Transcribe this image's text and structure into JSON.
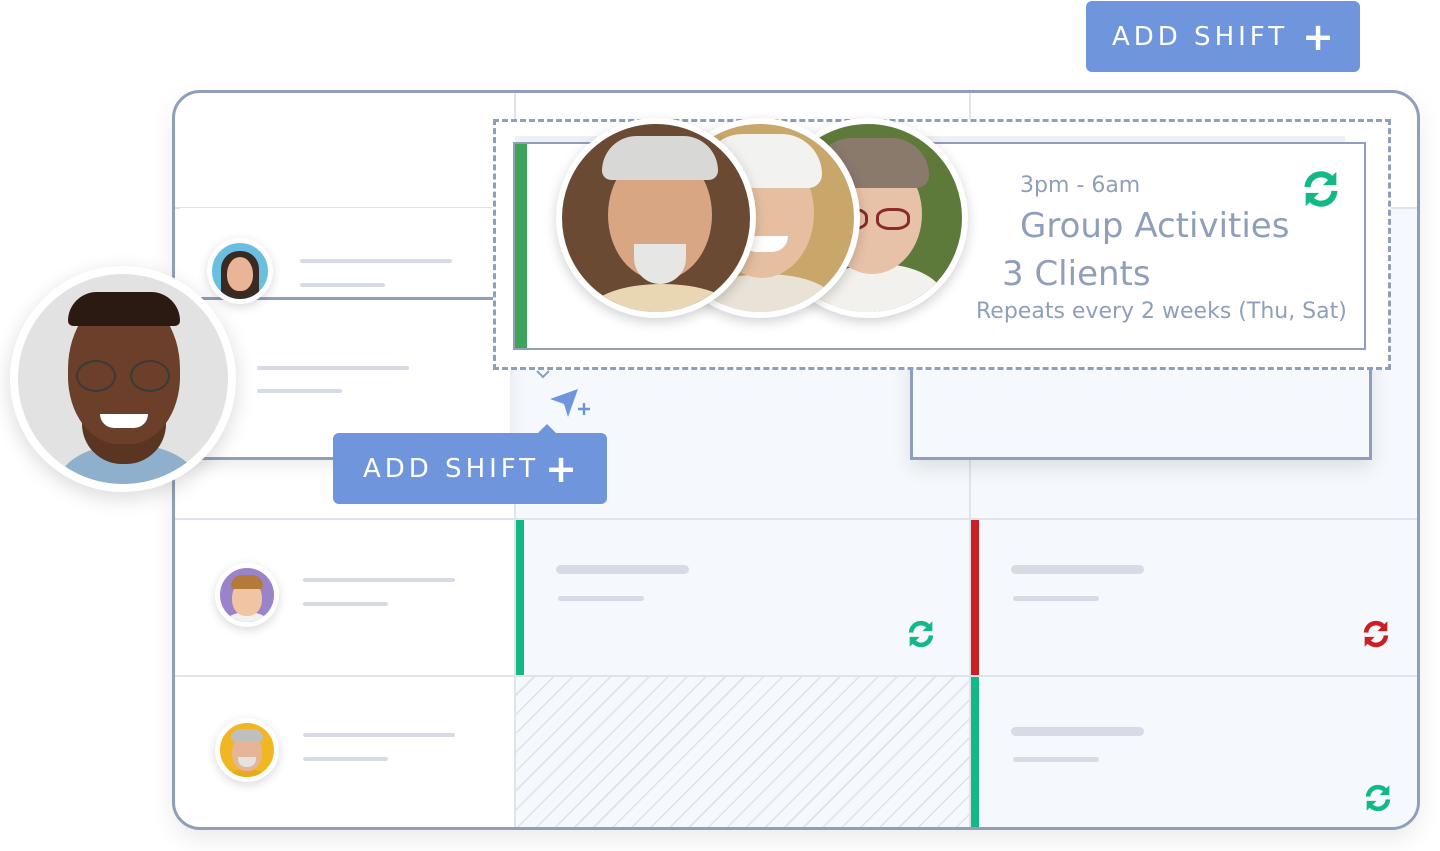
{
  "buttons": {
    "add_shift_top": {
      "label": "ADD SHIFT",
      "icon": "plus-icon"
    },
    "add_shift_inline": {
      "label": "ADD SHIFT",
      "icon": "plus-icon"
    }
  },
  "colors": {
    "accent": "#6f95dc",
    "frame_border": "#8f9fb9",
    "success_green": "#12b886",
    "shift_green": "#3fa45b",
    "alert_red": "#cc1f24",
    "skeleton": "#d6dbe6",
    "cell_bg": "#f5f8fc"
  },
  "dragged_shift": {
    "time": "3pm - 6am",
    "title": "Group Activities",
    "clients": "3 Clients",
    "recurrence": "Repeats every 2 weeks (Thu, Sat)",
    "status_icon": "repeat-sync-icon",
    "status_color": "green",
    "client_avatars": [
      "client-avatar-1",
      "client-avatar-2",
      "client-avatar-3"
    ]
  },
  "staff_rows": [
    {
      "avatar": "staff-avatar-woman-blue-bg"
    },
    {
      "avatar": "staff-avatar-man-glasses-large"
    },
    {
      "avatar": "staff-avatar-young-man-purple-bg"
    },
    {
      "avatar": "staff-avatar-older-man-yellow-bg"
    }
  ],
  "shift_cells": [
    {
      "row": 3,
      "col": 1,
      "stripe": "green",
      "sync_icon": "green"
    },
    {
      "row": 3,
      "col": 2,
      "stripe": "red",
      "sync_icon": "red"
    },
    {
      "row": 4,
      "col": 1,
      "unavailable": true
    },
    {
      "row": 4,
      "col": 2,
      "stripe": "green",
      "sync_icon": "green"
    }
  ],
  "drop_target_icon": "navigation-add-icon"
}
